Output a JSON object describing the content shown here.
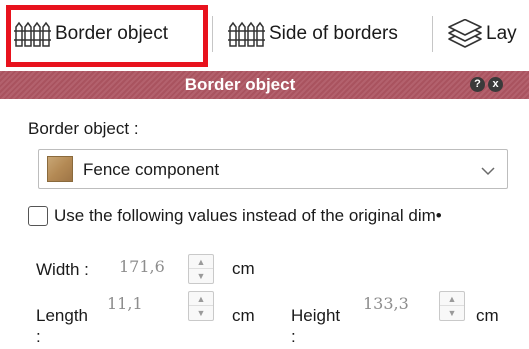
{
  "toolbar": {
    "border_object_label": "Border object",
    "side_of_borders_label": "Side of borders",
    "layers_label": "Lay",
    "icons": [
      "fence-icon",
      "fence-icon",
      "layers-icon"
    ]
  },
  "panel": {
    "title": "Border object",
    "help_glyph": "?",
    "close_glyph": "x",
    "border_object_label": "Border object :",
    "dropdown_value": "Fence component",
    "checkbox_label": "Use the following values instead of the original dim•",
    "checkbox_checked": false,
    "width": {
      "label": "Width :",
      "value": "171,6",
      "unit": "cm"
    },
    "length": {
      "label_line1": "Length",
      "label_line2": ":",
      "value": "11,1",
      "unit": "cm"
    },
    "height": {
      "label_line1": "Height",
      "label_line2": ":",
      "value": "133,3",
      "unit": "cm"
    }
  },
  "colors": {
    "highlight": "#e8121d",
    "titlebar": "#b3616d",
    "disabled_text": "#8d8d8d"
  }
}
